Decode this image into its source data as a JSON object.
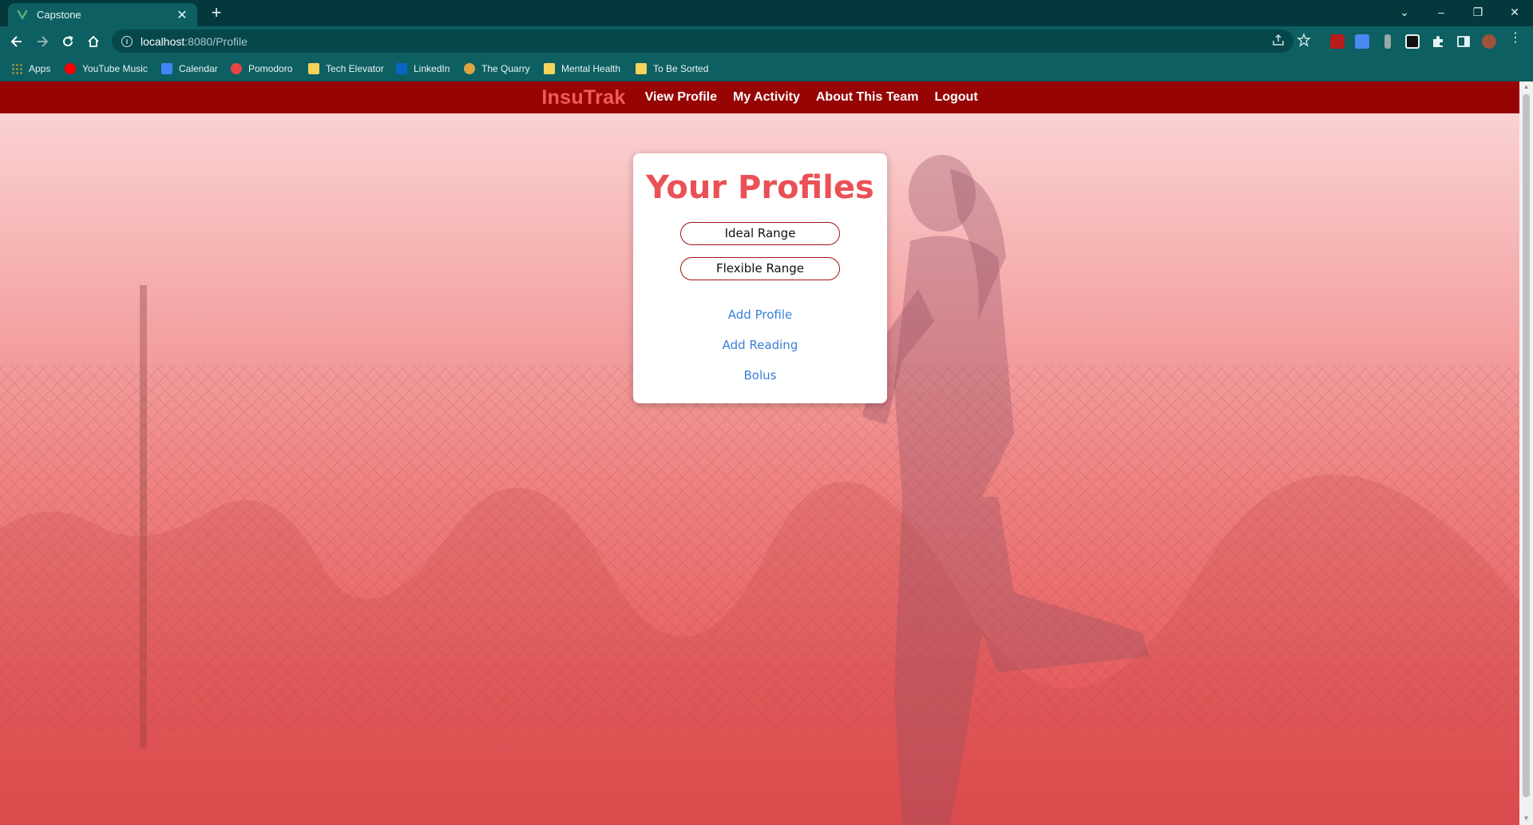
{
  "browser": {
    "tab_title": "Capstone",
    "url_host": "localhost",
    "url_path": ":8080/Profile"
  },
  "bookmarks": [
    {
      "label": "Apps",
      "icon": "apps-grid-icon",
      "color": "#f2b233"
    },
    {
      "label": "YouTube Music",
      "icon": "youtube-music-icon",
      "color": "#ff0000"
    },
    {
      "label": "Calendar",
      "icon": "calendar-icon",
      "color": "#4285f4"
    },
    {
      "label": "Pomodoro",
      "icon": "pomodoro-icon",
      "color": "#e84545"
    },
    {
      "label": "Tech Elevator",
      "icon": "folder-icon",
      "color": "#f6d35b"
    },
    {
      "label": "LinkedIn",
      "icon": "linkedin-icon",
      "color": "#0a66c2"
    },
    {
      "label": "The Quarry",
      "icon": "quarry-icon",
      "color": "#d9a441"
    },
    {
      "label": "Mental Health",
      "icon": "folder-icon",
      "color": "#f6d35b"
    },
    {
      "label": "To Be Sorted",
      "icon": "folder-icon",
      "color": "#f6d35b"
    }
  ],
  "navbar": {
    "brand": "InsuTrak",
    "links": [
      "View Profile",
      "My Activity",
      "About This Team",
      "Logout"
    ]
  },
  "card": {
    "title": "Your Profiles",
    "profiles": [
      "Ideal Range",
      "Flexible Range"
    ],
    "links": [
      "Add Profile",
      "Add Reading",
      "Bolus"
    ]
  },
  "colors": {
    "navbar_bg": "#970404",
    "brand": "#ef5c5c",
    "card_title": "#ea5156",
    "link": "#3b7fd6",
    "chrome": "#0d5f62"
  }
}
